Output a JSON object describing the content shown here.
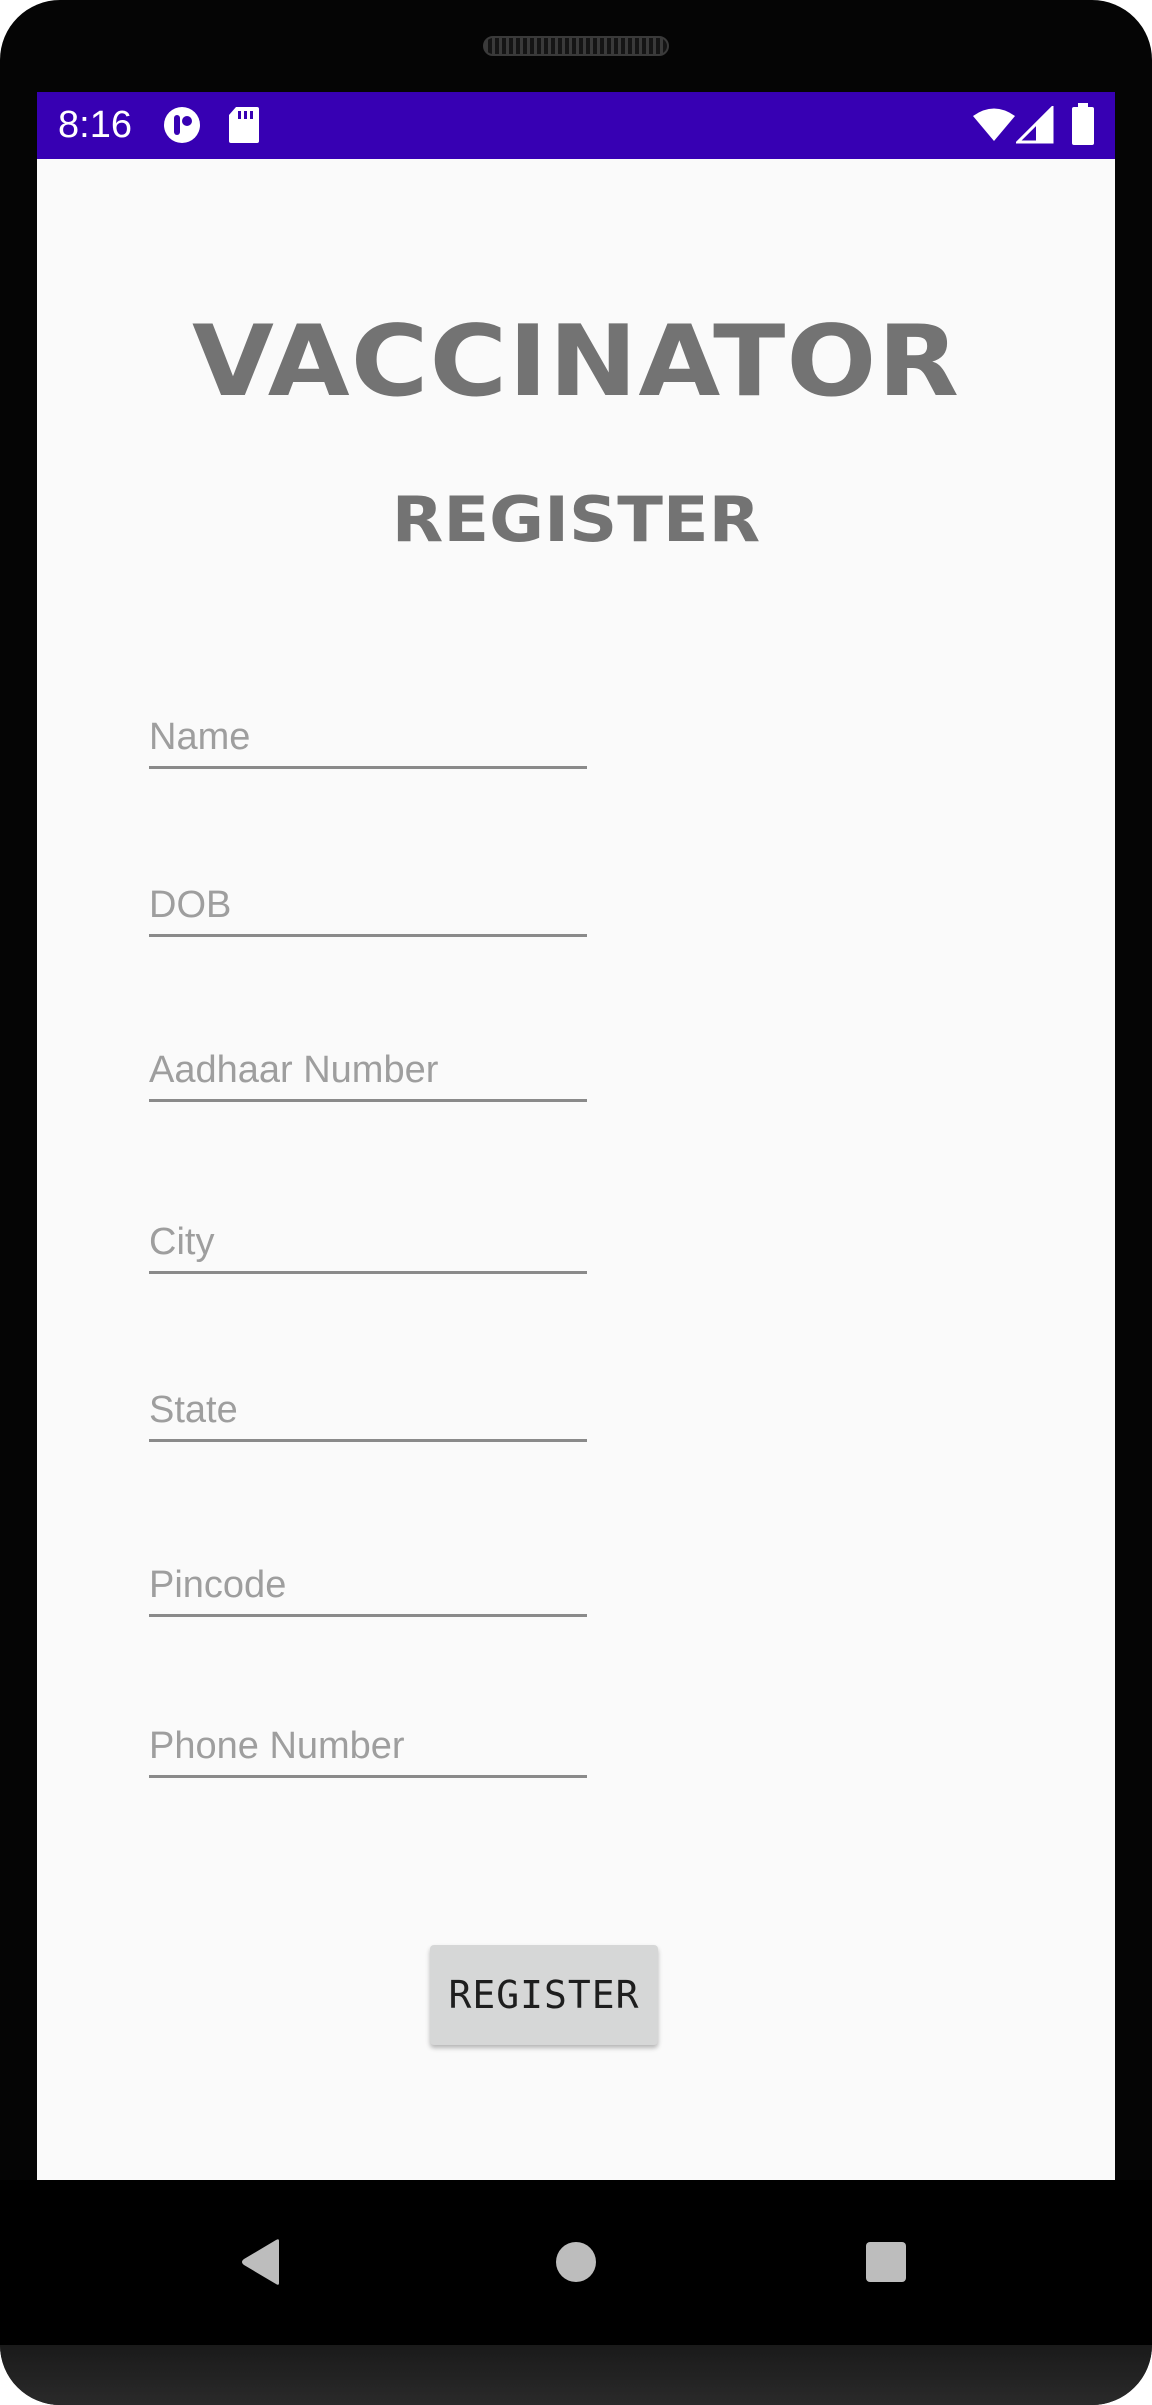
{
  "status_bar": {
    "time": "8:16",
    "background": "#3700b3",
    "left_icons": [
      "app-notification-icon",
      "sd-card-icon"
    ],
    "right_icons": [
      "wifi-icon",
      "cell-signal-icon",
      "battery-icon"
    ]
  },
  "app": {
    "title": "VACCINATOR",
    "subtitle": "REGISTER"
  },
  "form": {
    "fields": [
      {
        "id": "name",
        "placeholder": "Name",
        "value": ""
      },
      {
        "id": "dob",
        "placeholder": "DOB",
        "value": ""
      },
      {
        "id": "aadhaar",
        "placeholder": "Aadhaar Number",
        "value": ""
      },
      {
        "id": "city",
        "placeholder": "City",
        "value": ""
      },
      {
        "id": "state",
        "placeholder": "State",
        "value": ""
      },
      {
        "id": "pincode",
        "placeholder": "Pincode",
        "value": ""
      },
      {
        "id": "phone",
        "placeholder": "Phone Number",
        "value": ""
      }
    ],
    "submit_label": "REGISTER"
  },
  "navigation": {
    "buttons": [
      "back-icon",
      "home-icon",
      "recents-icon"
    ]
  },
  "colors": {
    "accent": "#3700b3",
    "title_gray": "#737373",
    "button_bg": "#d6d7d7"
  }
}
